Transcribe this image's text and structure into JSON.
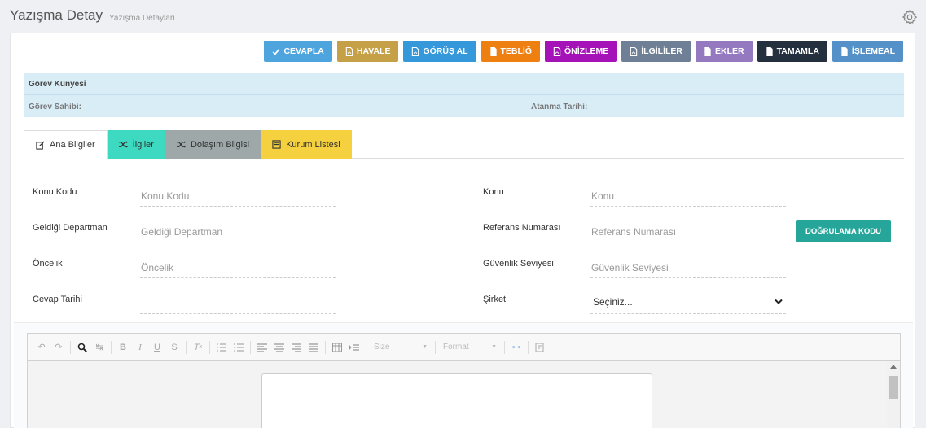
{
  "header": {
    "title": "Yazışma Detay",
    "subtitle": "Yazışma Detayları",
    "settings_icon": "gear-icon"
  },
  "toolbar": {
    "buttons": [
      {
        "label": "CEVAPLA",
        "color": "#4ea5de",
        "icon": "check-icon"
      },
      {
        "label": "HAVALE",
        "color": "#c5a046",
        "icon": "pdf-icon"
      },
      {
        "label": "GÖRÜŞ AL",
        "color": "#3498db",
        "icon": "pdf-icon"
      },
      {
        "label": "TEBLİĞ",
        "color": "#ee7f11",
        "icon": "file-icon"
      },
      {
        "label": "ÖNİZLEME",
        "color": "#a512b8",
        "icon": "pdf-icon"
      },
      {
        "label": "İLGİLİLER",
        "color": "#6f7f95",
        "icon": "pdf-icon"
      },
      {
        "label": "EKLER",
        "color": "#9479c0",
        "icon": "file-icon"
      },
      {
        "label": "TAMAMLA",
        "color": "#25303e",
        "icon": "file-icon"
      },
      {
        "label": "İŞLEMEAL",
        "color": "#5591c9",
        "icon": "file-icon"
      }
    ]
  },
  "kunye": {
    "title": "Görev Künyesi",
    "owner_label": "Görev Sahibi:",
    "date_label": "Atanma Tarihi:"
  },
  "tabs": [
    {
      "label": "Ana Bilgiler",
      "icon": "edit-icon",
      "color": "#ffffff",
      "text_color": "#333333",
      "active": true
    },
    {
      "label": "İlgiler",
      "icon": "shuffle-icon",
      "color": "#3dd9c1",
      "text_color": "#333333",
      "active": false
    },
    {
      "label": "Dolaşım Bilgisi",
      "icon": "shuffle-icon",
      "color": "#9ea8a8",
      "text_color": "#333333",
      "active": false
    },
    {
      "label": "Kurum Listesi",
      "icon": "list-icon",
      "color": "#f5d03f",
      "text_color": "#333333",
      "active": false
    }
  ],
  "form": {
    "konu_kodu": {
      "label": "Konu Kodu",
      "placeholder": "Konu Kodu",
      "value": ""
    },
    "konu": {
      "label": "Konu",
      "placeholder": "Konu",
      "value": ""
    },
    "geldigi_departman": {
      "label": "Geldiği Departman",
      "placeholder": "Geldiği Departman",
      "value": ""
    },
    "referans_numarasi": {
      "label": "Referans Numarası",
      "placeholder": "Referans Numarası",
      "value": ""
    },
    "oncelik": {
      "label": "Öncelik",
      "placeholder": "Öncelik",
      "value": ""
    },
    "guvenlik_seviyesi": {
      "label": "Güvenlik Seviyesi",
      "placeholder": "Güvenlik Seviyesi",
      "value": ""
    },
    "cevap_tarihi": {
      "label": "Cevap Tarihi",
      "value": ""
    },
    "sirket": {
      "label": "Şirket",
      "selected": "Seçiniz..."
    },
    "verify_button": "DOĞRULAMA KODU"
  },
  "editor": {
    "size_label": "Size",
    "format_label": "Format"
  }
}
